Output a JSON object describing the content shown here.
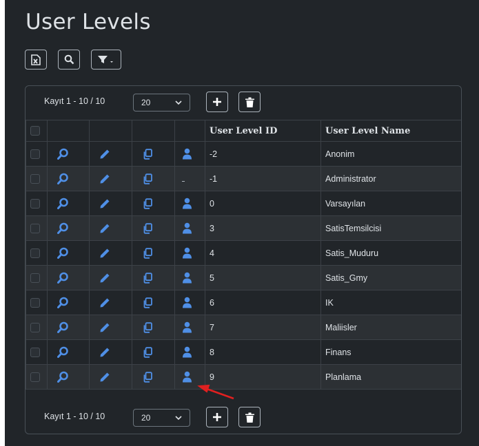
{
  "page": {
    "title": "User Levels"
  },
  "toolbar": {
    "buttons": [
      "export-excel",
      "search",
      "filter"
    ]
  },
  "pager_top": {
    "records": "Kayıt 1 - 10 / 10",
    "page_size": "20"
  },
  "pager_bottom": {
    "records": "Kayıt 1 - 10 / 10",
    "page_size": "20"
  },
  "table": {
    "columns": [
      "",
      "",
      "",
      "",
      "",
      "User Level ID",
      "User Level Name"
    ],
    "rows": [
      {
        "id": "-2",
        "name": "Anonim",
        "permission_icon": true
      },
      {
        "id": "-1",
        "name": "Administrator",
        "permission_icon": false
      },
      {
        "id": "0",
        "name": "Varsayılan",
        "permission_icon": true
      },
      {
        "id": "3",
        "name": "SatisTemsilcisi",
        "permission_icon": true
      },
      {
        "id": "4",
        "name": "Satis_Muduru",
        "permission_icon": true
      },
      {
        "id": "5",
        "name": "Satis_Gmy",
        "permission_icon": true
      },
      {
        "id": "6",
        "name": "IK",
        "permission_icon": true
      },
      {
        "id": "7",
        "name": "Maliisler",
        "permission_icon": true
      },
      {
        "id": "8",
        "name": "Finans",
        "permission_icon": true
      },
      {
        "id": "9",
        "name": "Planlama",
        "permission_icon": true
      }
    ]
  },
  "colors": {
    "background": "#212529",
    "icon_blue": "#4f8fe6",
    "annotation_arrow": "#e02020"
  },
  "icons": {
    "row_actions": [
      "view-icon",
      "edit-icon",
      "copy-icon",
      "permissions-icon"
    ]
  }
}
